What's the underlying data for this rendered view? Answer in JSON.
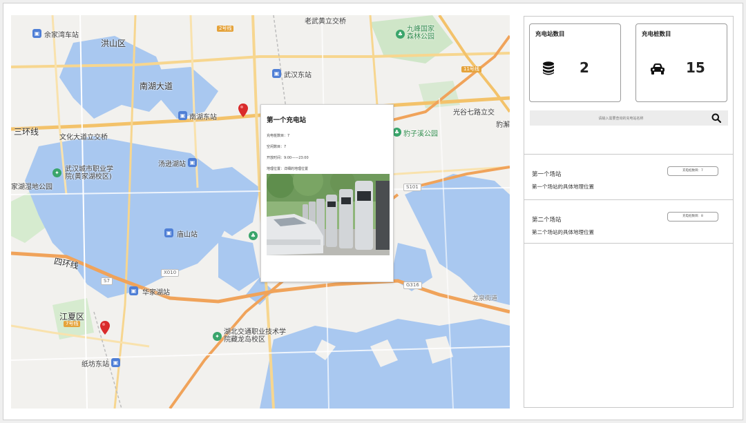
{
  "map": {
    "labels": {
      "hongshan": "洪山区",
      "nanhu": "南湖大道",
      "huaxinglu": "光谷七路立交",
      "sanhuan": "三环线",
      "wenhua": "文化大道立交桥",
      "wuhan_east": "武汉东站",
      "nanhu_east": "南湖东站",
      "laowu": "老武黄立交桥",
      "jiufeng": "九峰国家森林公园",
      "baozi": "豹子溪公园",
      "zhiye": "武汉城市职业学院(黄家湖校区)",
      "jiahu": "家湖湿地公园",
      "tanghu": "汤逊湖站",
      "miaoshan": "庙山站",
      "sihuan": "四环线",
      "huangjiahu": "华家湖站",
      "jiangxia": "江夏区",
      "zhifang_east": "纸坊东站",
      "jiaotong": "湖北交通职业技术学院藏龙岛校区",
      "liuhai": "流芳街道",
      "jiahu_station": "余家湾车站",
      "jiuxi": "豹澥",
      "lvjiao": "龙泉街道"
    }
  },
  "popup": {
    "title": "第一个充电站",
    "line1": "充电桩数目：7",
    "line2": "空闲数目：7",
    "line3": "开放时间：9:00——23:00",
    "line4": "地理位置：详细的地理位置"
  },
  "stats": {
    "station_count_title": "充电站数目",
    "station_count_value": "2",
    "charger_count_title": "充电桩数目",
    "charger_count_value": "15"
  },
  "search": {
    "placeholder": "请输入需要查询的充电站名称"
  },
  "stations": [
    {
      "name": "第一个场站",
      "address": "第一个场站的具体地理位置",
      "badge": "充电桩数目：7"
    },
    {
      "name": "第二个场站",
      "address": "第二个场站的具体地理位置",
      "badge": "充电桩数目：8"
    }
  ],
  "colors": {
    "water": "#a9c8f0",
    "land": "#f2f1ee",
    "road_major": "#f3c26a",
    "road_ring": "#f0a35a",
    "green": "#cfe6c8",
    "pin": "#d92b2b"
  }
}
